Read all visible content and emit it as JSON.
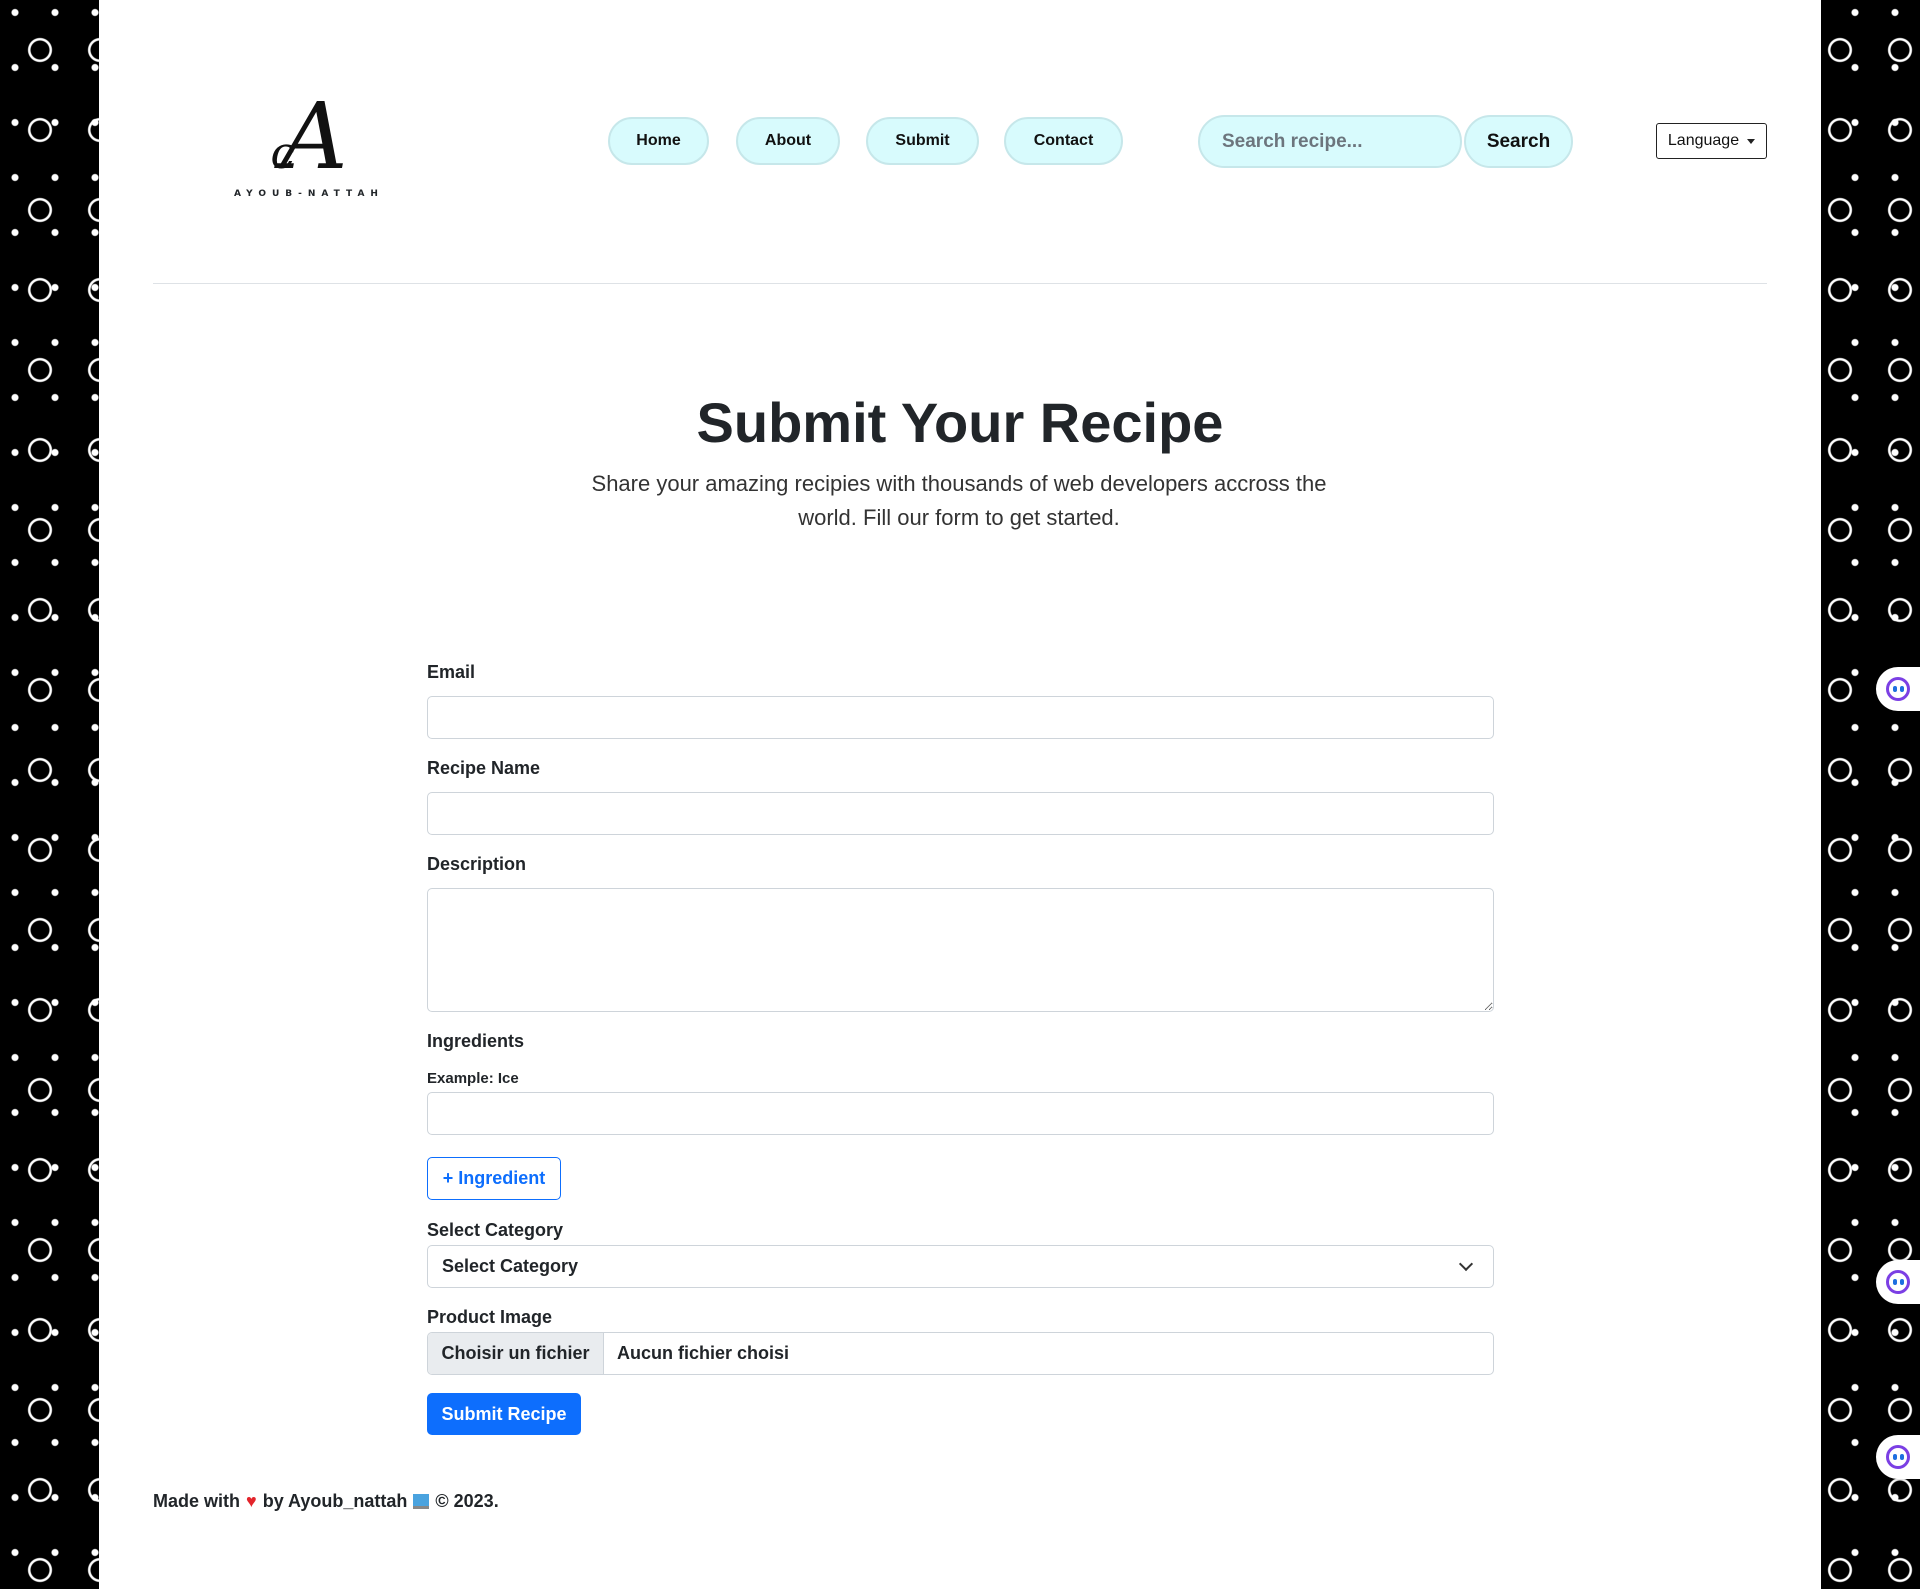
{
  "brand": {
    "logo_text": "AYOUB-NATTAH"
  },
  "nav": {
    "home": "Home",
    "about": "About",
    "submit": "Submit",
    "contact": "Contact"
  },
  "search": {
    "placeholder": "Search recipe...",
    "button": "Search"
  },
  "language": {
    "label": "Language"
  },
  "hero": {
    "title": "Submit Your Recipe",
    "subtitle": "Share your amazing recipies with thousands of web developers accross the world. Fill our form to get started."
  },
  "form": {
    "email_label": "Email",
    "email_value": "",
    "recipe_name_label": "Recipe Name",
    "recipe_name_value": "",
    "description_label": "Description",
    "description_value": "",
    "ingredients_label": "Ingredients",
    "ingredients_example": "Example: Ice",
    "ingredient_value": "",
    "add_ingredient_button": "+ Ingredient",
    "category_label": "Select Category",
    "category_selected": "Select Category",
    "image_label": "Product Image",
    "file_button": "Choisir un fichier",
    "file_status": "Aucun fichier choisi",
    "submit_button": "Submit Recipe"
  },
  "footer": {
    "made_with": "Made with",
    "by": "by Ayoub_nattah",
    "copyright": "© 2023."
  },
  "colors": {
    "nav_pill_bg": "#d8fbfd",
    "primary": "#0d6efd",
    "page_bg_pattern": "#000000"
  },
  "icons": [
    "heart-icon",
    "laptop-icon",
    "chevron-down-icon",
    "assistant-widget-icon"
  ]
}
